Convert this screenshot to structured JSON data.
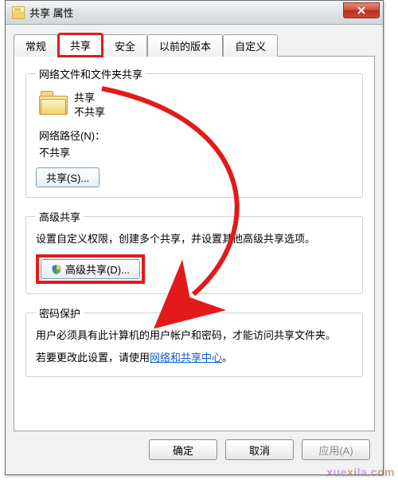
{
  "window": {
    "title": "共享 属性"
  },
  "tabs": {
    "items": [
      {
        "label": "常规"
      },
      {
        "label": "共享"
      },
      {
        "label": "安全"
      },
      {
        "label": "以前的版本"
      },
      {
        "label": "自定义"
      }
    ],
    "active_index": 1
  },
  "section_network": {
    "legend": "网络文件和文件夹共享",
    "folder_name": "共享",
    "share_status": "不共享",
    "path_label": "网络路径(N)：",
    "path_value": "不共享",
    "share_button": "共享(S)..."
  },
  "section_advanced": {
    "legend": "高级共享",
    "desc": "设置自定义权限，创建多个共享，并设置其他高级共享选项。",
    "adv_button": "高级共享(D)..."
  },
  "section_password": {
    "legend": "密码保护",
    "line1": "用户必须具有此计算机的用户帐户和密码，才能访问共享文件夹。",
    "line2_prefix": "若要更改此设置，请使用",
    "link_text": "网络和共享中心",
    "line2_suffix": "。"
  },
  "footer": {
    "ok": "确定",
    "cancel": "取消",
    "apply": "应用(A)"
  },
  "watermark": "xuexila.com",
  "icons": {
    "close": "close-icon",
    "folder": "folder-icon",
    "shield": "shield-icon"
  },
  "colors": {
    "highlight": "#e21a1a",
    "link": "#0a5bd8"
  }
}
